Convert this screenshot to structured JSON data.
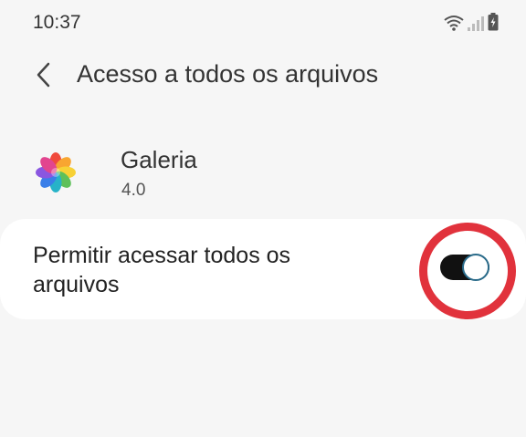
{
  "status_bar": {
    "time": "10:37",
    "icons": [
      "wifi-icon",
      "signal-icon",
      "battery-charging-icon"
    ]
  },
  "header": {
    "back_icon": "chevron-left-icon",
    "title": "Acesso a todos os arquivos"
  },
  "app": {
    "icon": "gallery-flower-icon",
    "name": "Galeria",
    "version": "4.0"
  },
  "permission": {
    "label": "Permitir acessar todos os arquivos",
    "enabled": true
  },
  "colors": {
    "background": "#f6f6f6",
    "card": "#ffffff",
    "toggle_track": "#111111",
    "highlight": "#e1323c"
  }
}
